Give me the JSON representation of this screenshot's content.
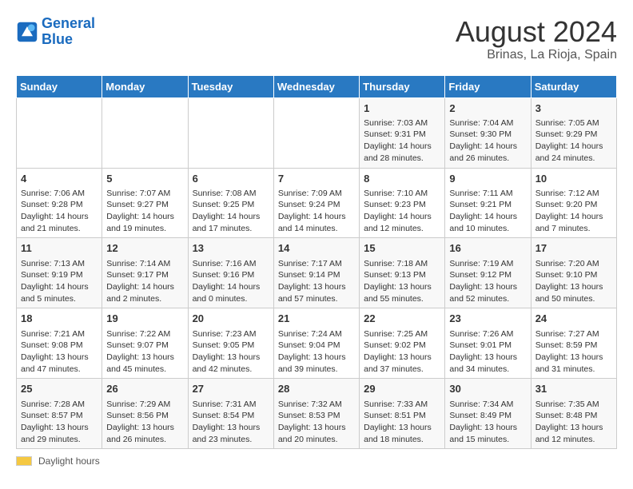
{
  "header": {
    "logo_line1": "General",
    "logo_line2": "Blue",
    "title": "August 2024",
    "subtitle": "Brinas, La Rioja, Spain"
  },
  "weekdays": [
    "Sunday",
    "Monday",
    "Tuesday",
    "Wednesday",
    "Thursday",
    "Friday",
    "Saturday"
  ],
  "weeks": [
    [
      {
        "day": "",
        "info": ""
      },
      {
        "day": "",
        "info": ""
      },
      {
        "day": "",
        "info": ""
      },
      {
        "day": "",
        "info": ""
      },
      {
        "day": "1",
        "info": "Sunrise: 7:03 AM\nSunset: 9:31 PM\nDaylight: 14 hours\nand 28 minutes."
      },
      {
        "day": "2",
        "info": "Sunrise: 7:04 AM\nSunset: 9:30 PM\nDaylight: 14 hours\nand 26 minutes."
      },
      {
        "day": "3",
        "info": "Sunrise: 7:05 AM\nSunset: 9:29 PM\nDaylight: 14 hours\nand 24 minutes."
      }
    ],
    [
      {
        "day": "4",
        "info": "Sunrise: 7:06 AM\nSunset: 9:28 PM\nDaylight: 14 hours\nand 21 minutes."
      },
      {
        "day": "5",
        "info": "Sunrise: 7:07 AM\nSunset: 9:27 PM\nDaylight: 14 hours\nand 19 minutes."
      },
      {
        "day": "6",
        "info": "Sunrise: 7:08 AM\nSunset: 9:25 PM\nDaylight: 14 hours\nand 17 minutes."
      },
      {
        "day": "7",
        "info": "Sunrise: 7:09 AM\nSunset: 9:24 PM\nDaylight: 14 hours\nand 14 minutes."
      },
      {
        "day": "8",
        "info": "Sunrise: 7:10 AM\nSunset: 9:23 PM\nDaylight: 14 hours\nand 12 minutes."
      },
      {
        "day": "9",
        "info": "Sunrise: 7:11 AM\nSunset: 9:21 PM\nDaylight: 14 hours\nand 10 minutes."
      },
      {
        "day": "10",
        "info": "Sunrise: 7:12 AM\nSunset: 9:20 PM\nDaylight: 14 hours\nand 7 minutes."
      }
    ],
    [
      {
        "day": "11",
        "info": "Sunrise: 7:13 AM\nSunset: 9:19 PM\nDaylight: 14 hours\nand 5 minutes."
      },
      {
        "day": "12",
        "info": "Sunrise: 7:14 AM\nSunset: 9:17 PM\nDaylight: 14 hours\nand 2 minutes."
      },
      {
        "day": "13",
        "info": "Sunrise: 7:16 AM\nSunset: 9:16 PM\nDaylight: 14 hours\nand 0 minutes."
      },
      {
        "day": "14",
        "info": "Sunrise: 7:17 AM\nSunset: 9:14 PM\nDaylight: 13 hours\nand 57 minutes."
      },
      {
        "day": "15",
        "info": "Sunrise: 7:18 AM\nSunset: 9:13 PM\nDaylight: 13 hours\nand 55 minutes."
      },
      {
        "day": "16",
        "info": "Sunrise: 7:19 AM\nSunset: 9:12 PM\nDaylight: 13 hours\nand 52 minutes."
      },
      {
        "day": "17",
        "info": "Sunrise: 7:20 AM\nSunset: 9:10 PM\nDaylight: 13 hours\nand 50 minutes."
      }
    ],
    [
      {
        "day": "18",
        "info": "Sunrise: 7:21 AM\nSunset: 9:08 PM\nDaylight: 13 hours\nand 47 minutes."
      },
      {
        "day": "19",
        "info": "Sunrise: 7:22 AM\nSunset: 9:07 PM\nDaylight: 13 hours\nand 45 minutes."
      },
      {
        "day": "20",
        "info": "Sunrise: 7:23 AM\nSunset: 9:05 PM\nDaylight: 13 hours\nand 42 minutes."
      },
      {
        "day": "21",
        "info": "Sunrise: 7:24 AM\nSunset: 9:04 PM\nDaylight: 13 hours\nand 39 minutes."
      },
      {
        "day": "22",
        "info": "Sunrise: 7:25 AM\nSunset: 9:02 PM\nDaylight: 13 hours\nand 37 minutes."
      },
      {
        "day": "23",
        "info": "Sunrise: 7:26 AM\nSunset: 9:01 PM\nDaylight: 13 hours\nand 34 minutes."
      },
      {
        "day": "24",
        "info": "Sunrise: 7:27 AM\nSunset: 8:59 PM\nDaylight: 13 hours\nand 31 minutes."
      }
    ],
    [
      {
        "day": "25",
        "info": "Sunrise: 7:28 AM\nSunset: 8:57 PM\nDaylight: 13 hours\nand 29 minutes."
      },
      {
        "day": "26",
        "info": "Sunrise: 7:29 AM\nSunset: 8:56 PM\nDaylight: 13 hours\nand 26 minutes."
      },
      {
        "day": "27",
        "info": "Sunrise: 7:31 AM\nSunset: 8:54 PM\nDaylight: 13 hours\nand 23 minutes."
      },
      {
        "day": "28",
        "info": "Sunrise: 7:32 AM\nSunset: 8:53 PM\nDaylight: 13 hours\nand 20 minutes."
      },
      {
        "day": "29",
        "info": "Sunrise: 7:33 AM\nSunset: 8:51 PM\nDaylight: 13 hours\nand 18 minutes."
      },
      {
        "day": "30",
        "info": "Sunrise: 7:34 AM\nSunset: 8:49 PM\nDaylight: 13 hours\nand 15 minutes."
      },
      {
        "day": "31",
        "info": "Sunrise: 7:35 AM\nSunset: 8:48 PM\nDaylight: 13 hours\nand 12 minutes."
      }
    ]
  ],
  "footer": {
    "daylight_label": "Daylight hours"
  }
}
